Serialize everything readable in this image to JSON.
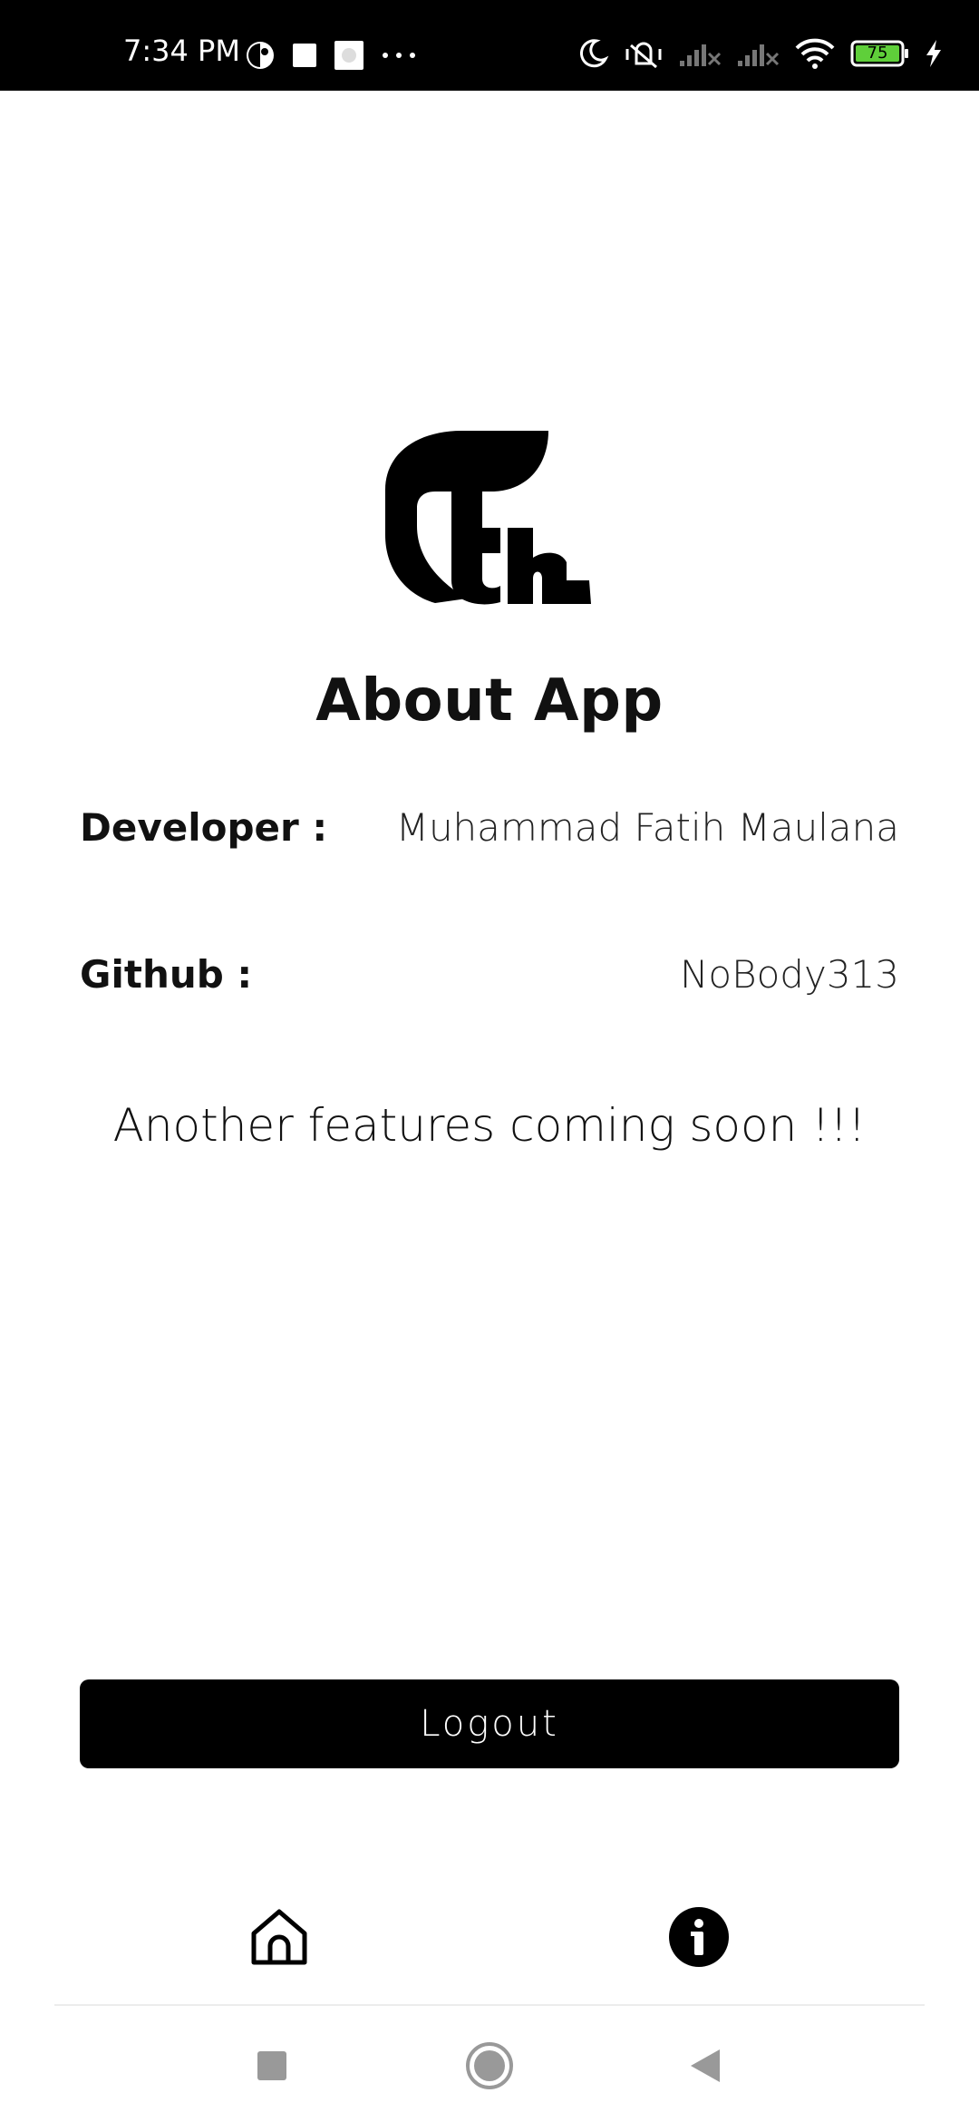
{
  "status_bar": {
    "time": "7:34 PM",
    "battery_level": "75",
    "icons": [
      "notification-icon",
      "square-notification-icon",
      "image-notification-icon",
      "more-dots-icon",
      "moon-icon",
      "vibrate-off-icon",
      "signal-icon",
      "signal-icon",
      "wifi-icon",
      "battery-icon",
      "charging-icon"
    ]
  },
  "page": {
    "title": "About App",
    "developer_label": "Developer :",
    "developer_value": "Muhammad Fatih Maulana",
    "github_label": "Github :",
    "github_value": "NoBody313",
    "coming_soon": "Another features coming soon !!!",
    "logout_label": "Logout"
  },
  "bottom_nav": {
    "items": [
      {
        "icon": "home-icon",
        "active": false
      },
      {
        "icon": "info-icon",
        "active": true
      }
    ]
  },
  "system_nav": {
    "buttons": [
      "recents-button",
      "home-button",
      "back-button"
    ]
  },
  "colors": {
    "primary": "#000000",
    "background": "#ffffff",
    "battery_fill": "#5fcf3a"
  }
}
